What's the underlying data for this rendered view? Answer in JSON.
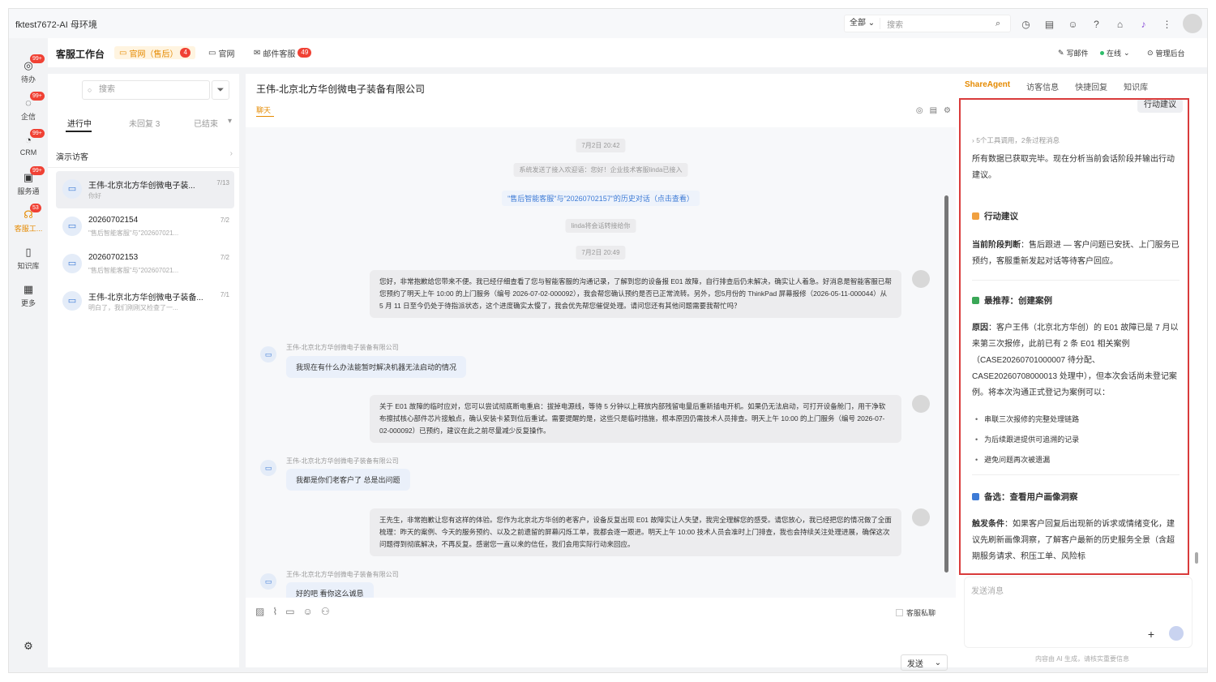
{
  "window": {
    "title": "fktest7672-AI 母环境"
  },
  "global_search": {
    "scope": "全部",
    "placeholder": "搜索"
  },
  "rail": [
    {
      "label": "待办",
      "badge": "99+"
    },
    {
      "label": "企信",
      "badge": "99+"
    },
    {
      "label": "CRM",
      "badge": "99+"
    },
    {
      "label": "服务通",
      "badge": "99+"
    },
    {
      "label": "客服工...",
      "badge": "53"
    },
    {
      "label": "知识库",
      "badge": ""
    },
    {
      "label": "更多",
      "badge": ""
    }
  ],
  "header": {
    "workbench": "客服工作台",
    "tabs": [
      {
        "label": "官网（售后）",
        "count": "4"
      },
      {
        "label": "官网",
        "count": ""
      },
      {
        "label": "邮件客服",
        "count": "49"
      }
    ],
    "write_mail": "写邮件",
    "status": "在线",
    "admin": "管理后台"
  },
  "list": {
    "search_placeholder": "搜索",
    "tabs": [
      "进行中",
      "未回复 3",
      "已结束"
    ],
    "section": "演示访客",
    "items": [
      {
        "name": "王伟-北京北方华创微电子装...",
        "snippet": "你好",
        "date": "7/13"
      },
      {
        "name": "20260702154",
        "snippet": "\"售后智能客服\"与\"202607021...",
        "date": "7/2"
      },
      {
        "name": "20260702153",
        "snippet": "\"售后智能客服\"与\"202607021...",
        "date": "7/2"
      },
      {
        "name": "王伟-北京北方华创微电子装备...",
        "snippet": "明白了，我们刚刚又检查了一...",
        "date": "7/1"
      }
    ]
  },
  "chat": {
    "title": "王伟-北京北方华创微电子装备有限公司",
    "subtab": "聊天",
    "pills": {
      "t1": "7月2日 20:42",
      "sys1": "系统发送了接入欢迎语：您好！企业技术客服linda已接入",
      "history": "\"售后智能客服\"与\"20260702157\"的历史对话（点击查看）",
      "transfer": "linda将会话转接给你",
      "t2": "7月2日 20:49"
    },
    "customer_name": "王伟-北京北方华创微电子装备有限公司",
    "msgs": {
      "a1": "您好，非常抱歉给您带来不便。我已经仔细查看了您与智能客服的沟通记录，了解到您的设备报 E01 故障，自行排查后仍未解决，确实让人着急。好消息是智能客服已帮您预约了明天上午 10:00 的上门服务（编号 2026-07-02-000092），我会帮您确认预约是否已正常流转。另外，您5月份的 ThinkPad 屏幕报修（2026-05-11-000044）从 5 月 11 日至今仍处于待指派状态，这个进度确实太慢了，我会优先帮您催促处理。请问您还有其他问题需要我帮忙吗？",
      "c1": "我现在有什么办法能暂时解决机器无法启动的情况",
      "a2": "关于 E01 故障的临时应对，您可以尝试彻底断电重启：拔掉电源线，等待 5 分钟以上释放内部残留电量后重新插电开机。如果仍无法启动，可打开设备舱门，用干净软布擦拭核心部件芯片接触点，确认安装卡紧到位后重试。需要提醒的是，这些只是临时措施，根本原因仍需技术人员排查。明天上午 10:00 的上门服务（编号 2026-07-02-000092）已预约，建议在此之前尽量减少反复操作。",
      "c2": "我都是你们老客户了 总是出问题",
      "a3": "王先生，非常抱歉让您有这样的体验。您作为北京北方华创的老客户，设备反复出现 E01 故障实让人失望，我完全理解您的感受。请您放心，我已经把您的情况做了全面梳理：昨天的案例、今天的服务预约、以及之前遗留的屏幕闪烁工单，我都会逐一跟进。明天上午 10:00 技术人员会准时上门排查，我也会持续关注处理进展，确保这次问题得到彻底解决，不再反复。感谢您一直以来的信任，我们会用实际行动来回应。",
      "c3": "好的吧 看你这么诚恳"
    },
    "private_label": "客服私聊",
    "send": "发送"
  },
  "agent": {
    "tabs": [
      "ShareAgent",
      "访客信息",
      "快捷回复",
      "知识库"
    ],
    "action_chip": "行动建议",
    "tools_line": "5个工具调用，2条过程消息",
    "intro": "所有数据已获取完毕。现在分析当前会话阶段并输出行动建议。",
    "action_title": "行动建议",
    "stage_label": "当前阶段判断",
    "stage_text": "：售后跟进 — 客户问题已安抚、上门服务已预约，客服重新发起对话等待客户回应。",
    "rec_title": "最推荐：创建案例",
    "reason_label": "原因",
    "reason_text": "：客户王伟（北京北方华创）的 E01 故障已是 7 月以来第三次报修，此前已有 2 条 E01 相关案例（CASE20260701000007 待分配、CASE20260708000013 处理中），但本次会话尚未登记案例。将本次沟通正式登记为案例可以：",
    "bullets": [
      "串联三次报修的完整处理链路",
      "为后续跟进提供可追溯的记录",
      "避免问题再次被遗漏"
    ],
    "alt_title": "备选：查看用户画像洞察",
    "trigger_label": "触发条件",
    "trigger_text": "：如果客户回复后出现新的诉求或情绪变化，建议先刷新画像洞察，了解客户最新的历史服务全景（含超期服务请求、积压工单、风险标",
    "input_placeholder": "发送消息",
    "disclaimer": "内容由 AI 生成，请核实重要信息"
  },
  "colors": {
    "accent": "#e58a00",
    "badge": "#f04134",
    "highlight_border": "#d93b3b",
    "link": "#3d7bd6"
  }
}
